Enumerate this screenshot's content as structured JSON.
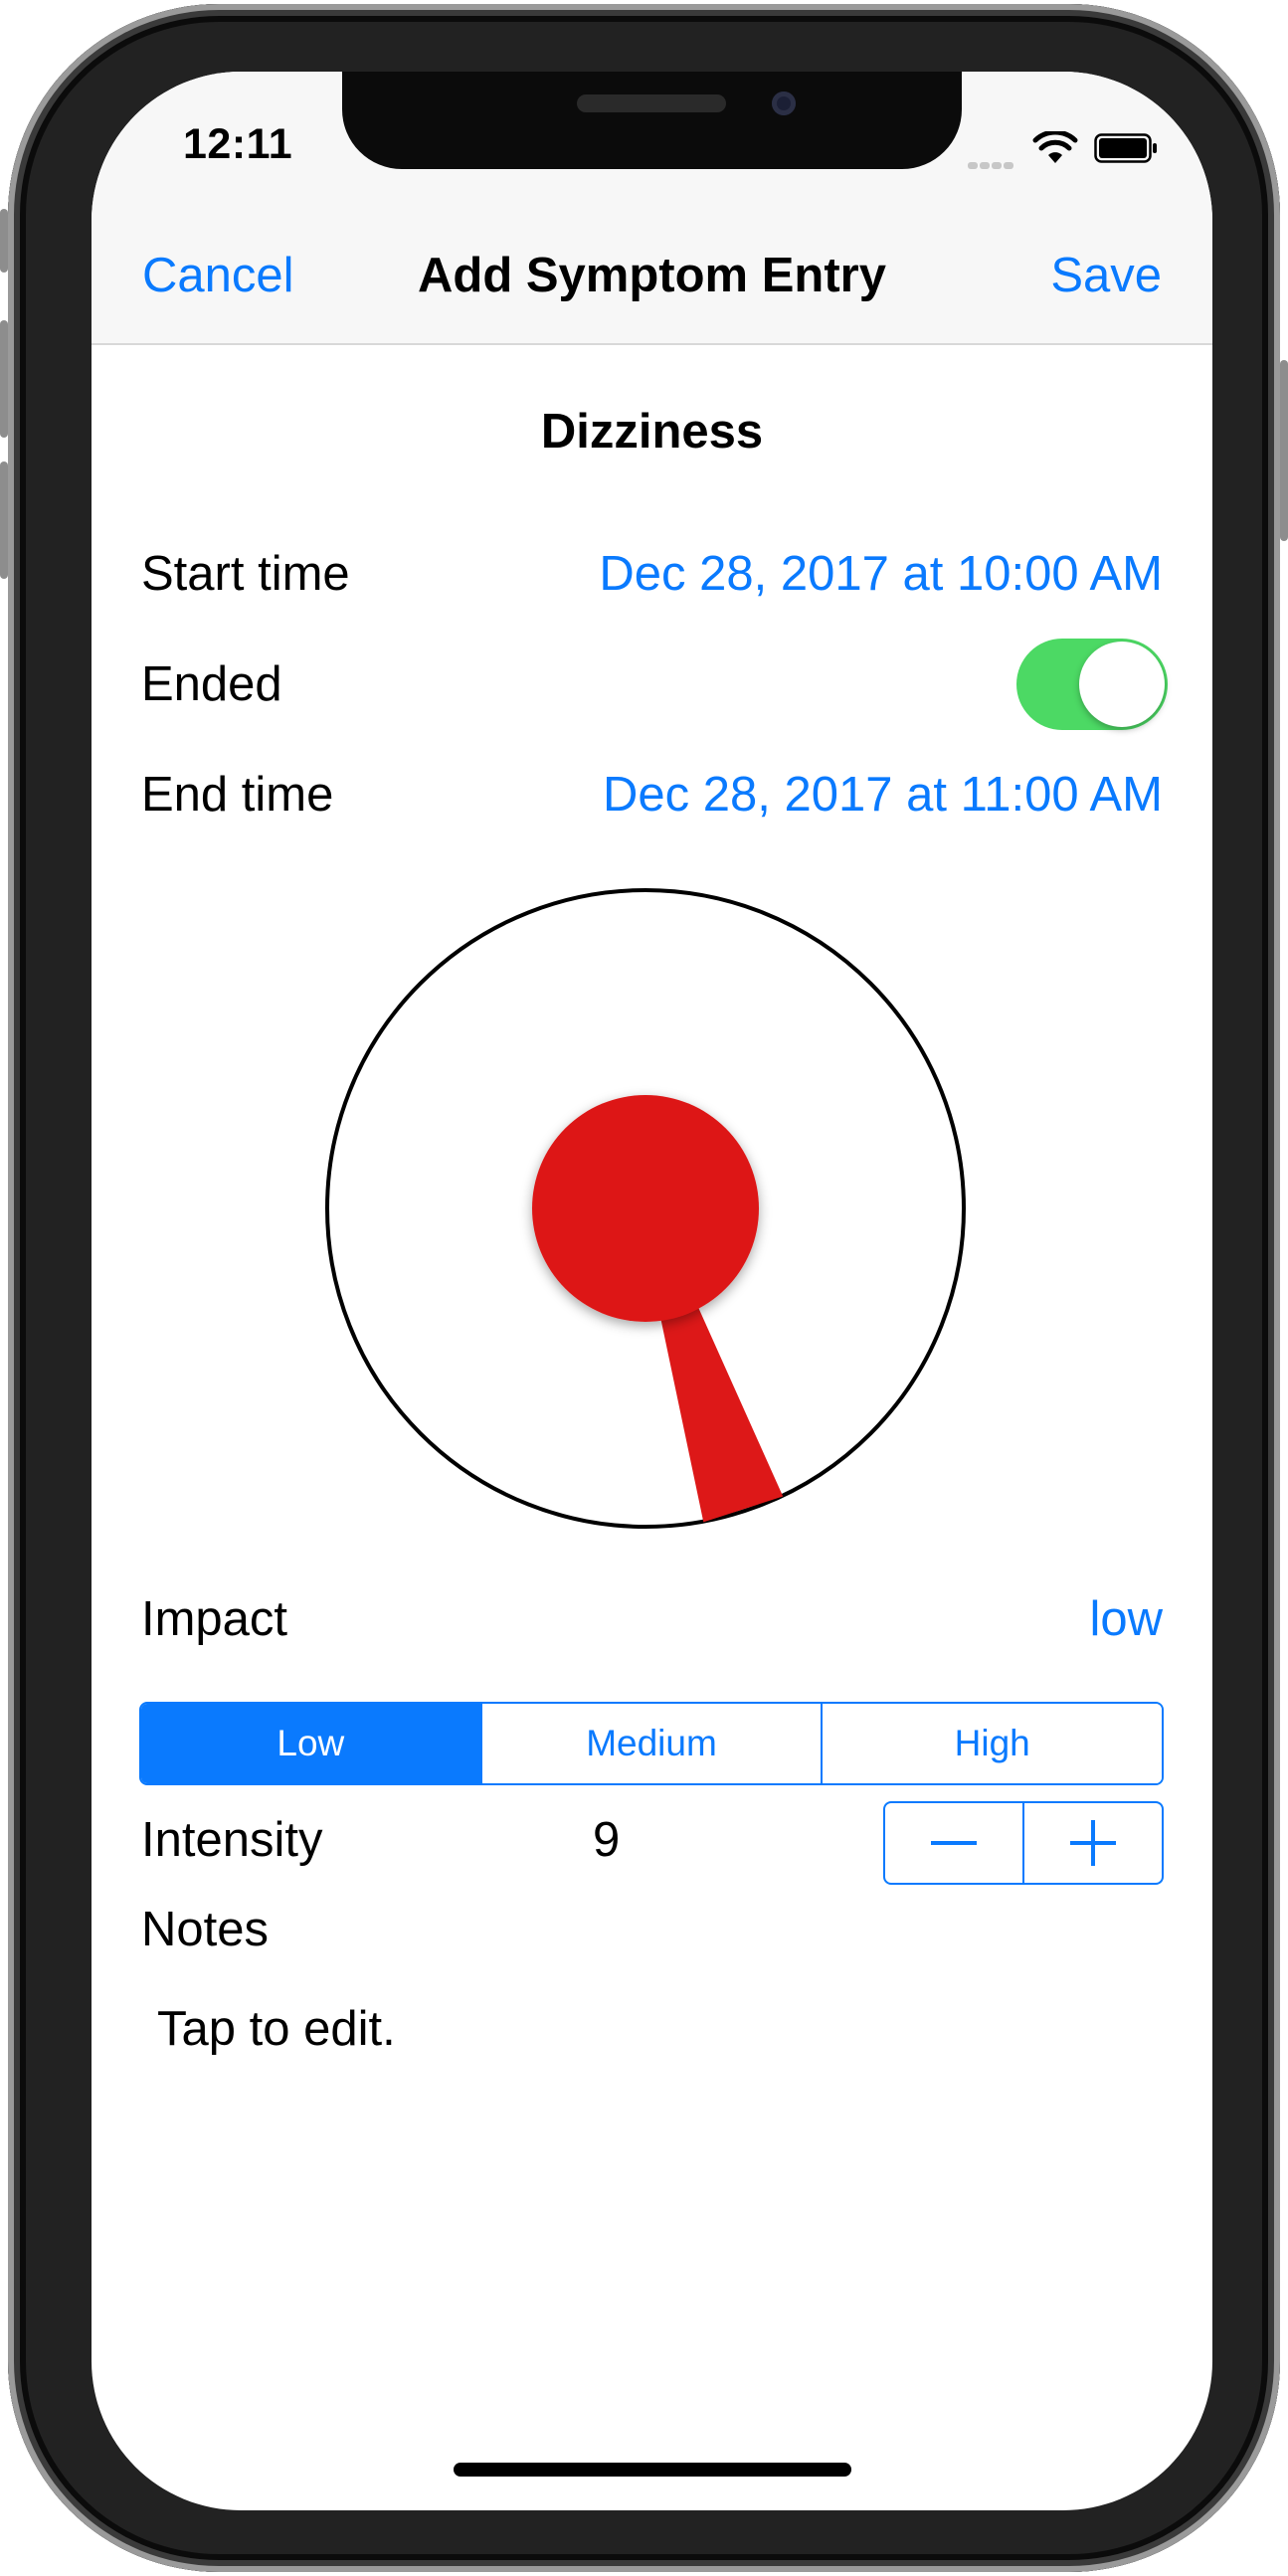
{
  "status_bar": {
    "time": "12:11",
    "icons": [
      "cellular-signal-icon",
      "wifi-icon",
      "battery-icon"
    ]
  },
  "nav": {
    "cancel_label": "Cancel",
    "title": "Add Symptom Entry",
    "save_label": "Save"
  },
  "symptom": {
    "name": "Dizziness"
  },
  "fields": {
    "start_time_label": "Start time",
    "start_time_value": "Dec 28, 2017 at 10:00 AM",
    "ended_label": "Ended",
    "ended_on": true,
    "end_time_label": "End time",
    "end_time_value": "Dec 28, 2017 at 11:00 AM"
  },
  "dial": {
    "pointer_value_fraction": 0.45,
    "knob_color": "#dd1818",
    "ring_color": "#000000"
  },
  "impact": {
    "label": "Impact",
    "value": "low",
    "options": [
      "Low",
      "Medium",
      "High"
    ],
    "selected": "Low"
  },
  "intensity": {
    "label": "Intensity",
    "value": "9",
    "decrement_symbol": "minus-icon",
    "increment_symbol": "plus-icon"
  },
  "notes": {
    "label": "Notes",
    "placeholder": "Tap to edit."
  },
  "colors": {
    "accent": "#0a7afe",
    "switch_on": "#4cd964",
    "knob_red": "#dd1818"
  }
}
